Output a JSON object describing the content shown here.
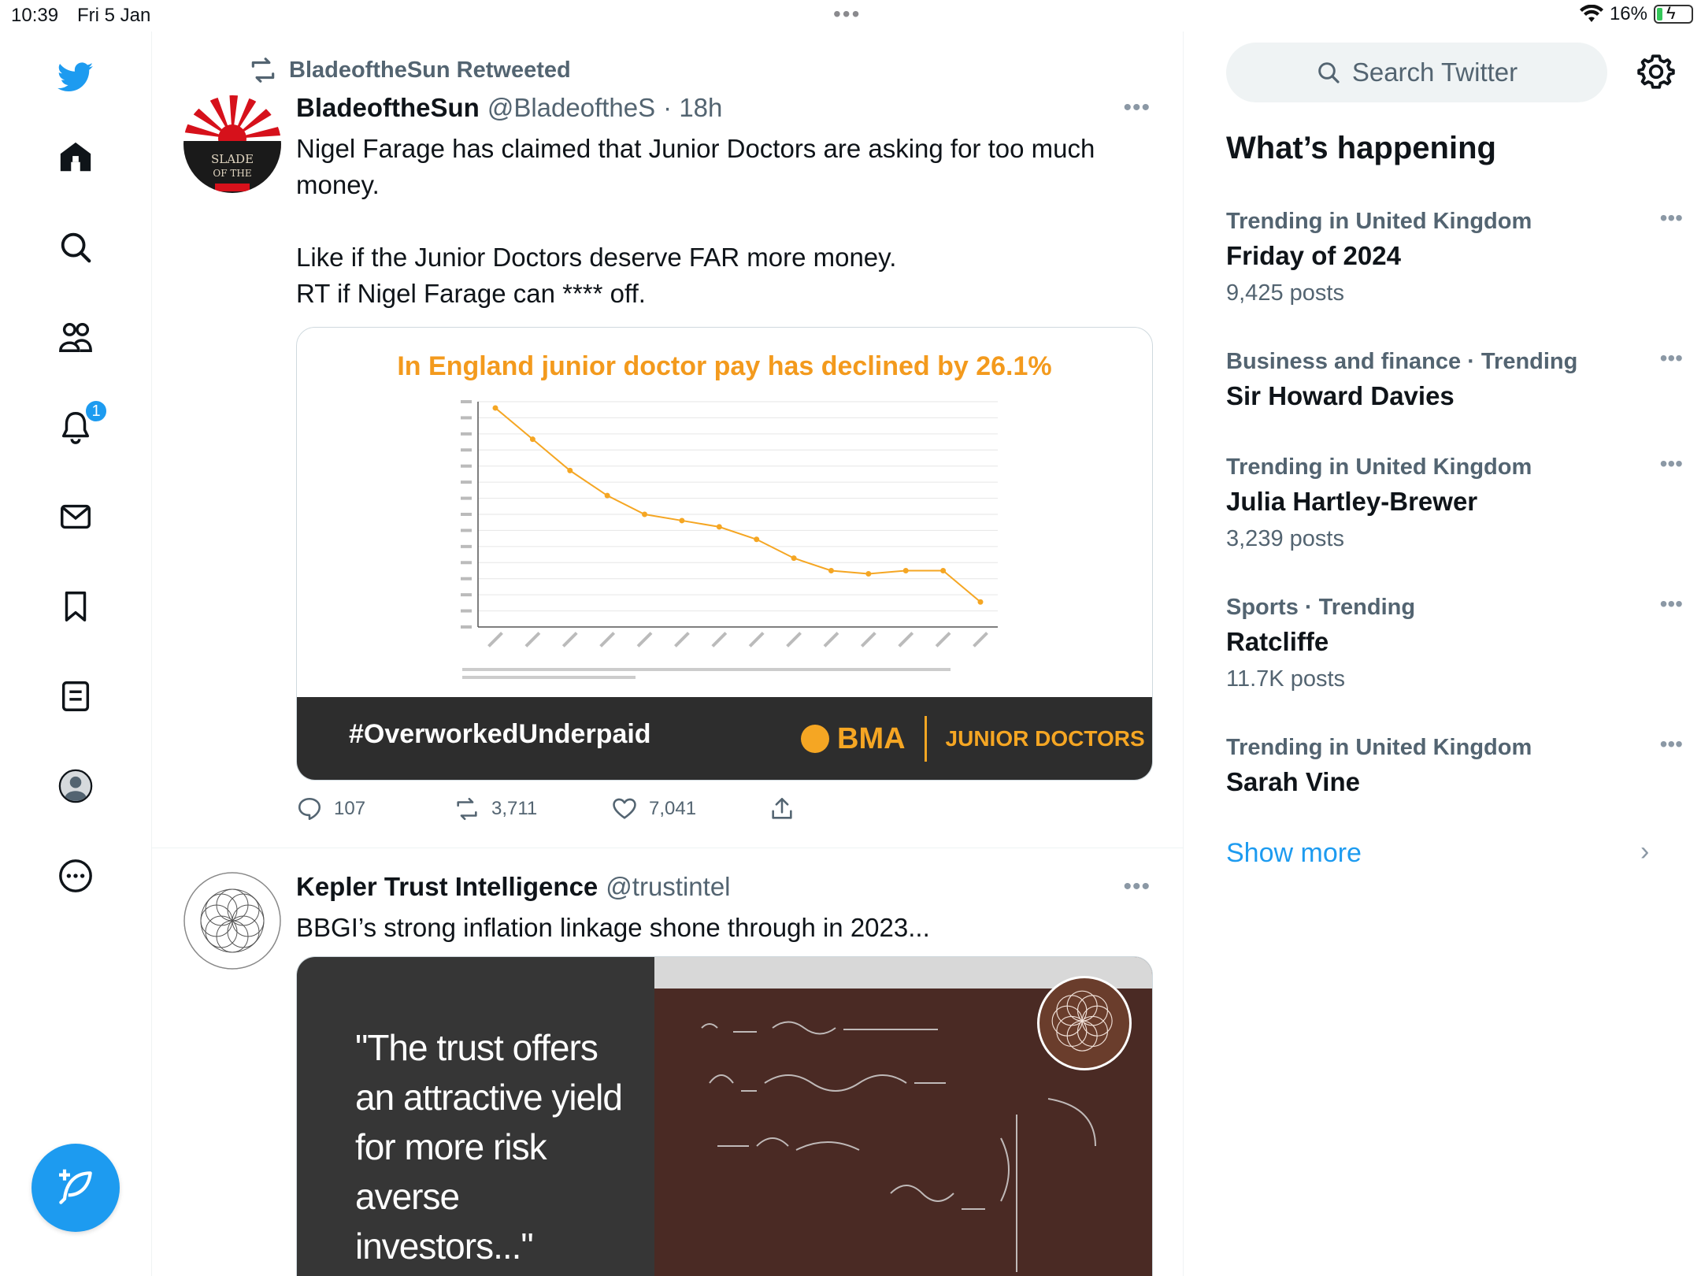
{
  "status_bar": {
    "time": "10:39",
    "date": "Fri 5 Jan",
    "battery": "16%"
  },
  "nav": {
    "notification_count": "1",
    "items": [
      "twitter-logo",
      "home-icon",
      "search-icon",
      "communities-icon",
      "bell-icon",
      "mail-icon",
      "bookmark-icon",
      "lists-icon",
      "profile-icon",
      "more-icon"
    ]
  },
  "tweets": [
    {
      "retweeted_by": "BladeoftheSun Retweeted",
      "name": "BladeoftheSun",
      "handle": "@BladeoftheS",
      "time": "· 18h",
      "text": "Nigel Farage has claimed that Junior Doctors are asking for too much money.\n\nLike if the Junior Doctors deserve FAR more money.\nRT if Nigel Farage can **** off.",
      "media": {
        "chart_title": "In England junior doctor pay has declined by 26.1%",
        "hashtag": "#OverworkedUnderpaid",
        "brand": "BMA",
        "brand_sub": "JUNIOR DOCTORS"
      },
      "replies": "107",
      "retweets": "3,711",
      "likes": "7,041"
    },
    {
      "name": "Kepler Trust Intelligence",
      "handle": "@trustintel",
      "text": "BBGI’s strong inflation linkage shone through in 2023...",
      "media": {
        "quote": "\"The trust offers an attractive yield for more risk averse investors...\""
      }
    }
  ],
  "chart_data": {
    "type": "line",
    "title": "In England junior doctor pay has declined by 26.1%",
    "values": [
      100,
      95,
      90,
      86,
      83,
      82,
      81,
      79,
      76,
      74,
      73.5,
      74,
      74,
      69
    ],
    "ylim": [
      65,
      101
    ],
    "grid": true,
    "color": "#f5a623"
  },
  "sidebar": {
    "search_placeholder": "Search Twitter",
    "section_title": "What’s happening",
    "trends": [
      {
        "context": "Trending in United Kingdom",
        "name": "Friday of 2024",
        "count": "9,425 posts"
      },
      {
        "context": "Business and finance · Trending",
        "name": "Sir Howard Davies",
        "count": ""
      },
      {
        "context": "Trending in United Kingdom",
        "name": "Julia Hartley-Brewer",
        "count": "3,239 posts"
      },
      {
        "context": "Sports · Trending",
        "name": "Ratcliffe",
        "count": "11.7K posts"
      },
      {
        "context": "Trending in United Kingdom",
        "name": "Sarah Vine",
        "count": ""
      }
    ],
    "show_more": "Show more"
  },
  "colors": {
    "accent": "#1d9bf0",
    "text": "#0f1419",
    "muted": "#536471",
    "chart": "#f5a623"
  }
}
